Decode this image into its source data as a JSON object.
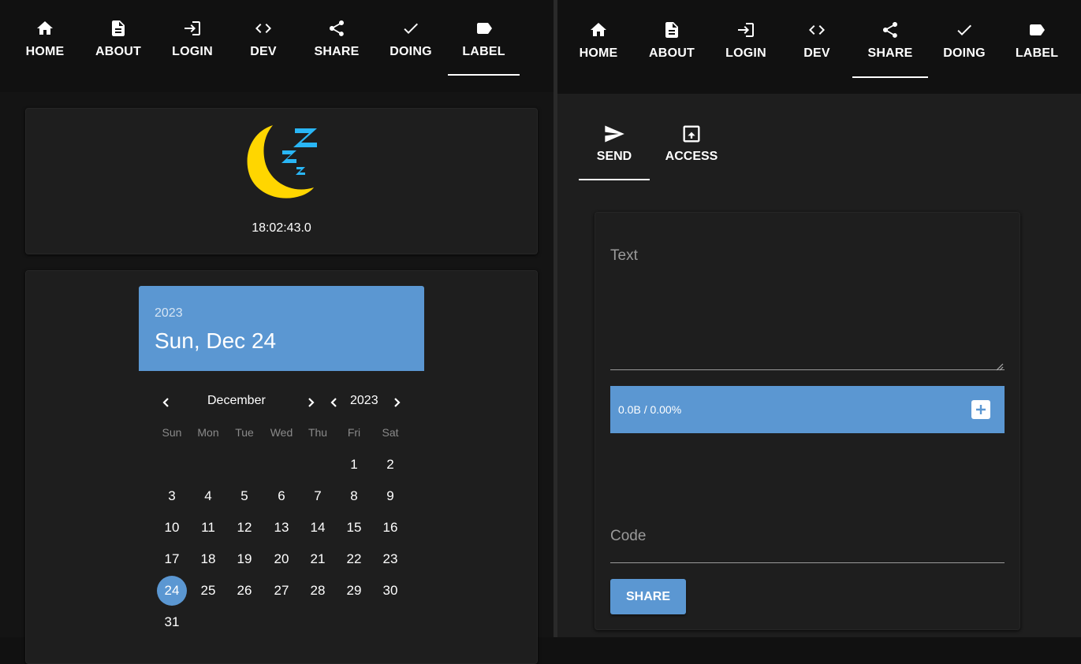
{
  "left_nav": {
    "items": [
      {
        "label": "HOME"
      },
      {
        "label": "ABOUT"
      },
      {
        "label": "LOGIN"
      },
      {
        "label": "DEV"
      },
      {
        "label": "SHARE"
      },
      {
        "label": "DOING"
      },
      {
        "label": "LABEL"
      }
    ],
    "active": "LABEL"
  },
  "right_nav": {
    "items": [
      {
        "label": "HOME"
      },
      {
        "label": "ABOUT"
      },
      {
        "label": "LOGIN"
      },
      {
        "label": "DEV"
      },
      {
        "label": "SHARE"
      },
      {
        "label": "DOING"
      },
      {
        "label": "LABEL"
      }
    ],
    "active": "SHARE"
  },
  "clock": {
    "icon": "sleeping-moon-icon",
    "time": "18:02:43.0",
    "colors": {
      "moon": "#ffd600",
      "z": "#29b6f6"
    }
  },
  "calendar": {
    "header_year": "2023",
    "header_date": "Sun, Dec 24",
    "month": "December",
    "year": "2023",
    "weekdays": [
      "Sun",
      "Mon",
      "Tue",
      "Wed",
      "Thu",
      "Fri",
      "Sat"
    ],
    "days": [
      "1",
      "2",
      "3",
      "4",
      "5",
      "6",
      "7",
      "8",
      "9",
      "10",
      "11",
      "12",
      "13",
      "14",
      "15",
      "16",
      "17",
      "18",
      "19",
      "20",
      "21",
      "22",
      "23",
      "24",
      "25",
      "26",
      "27",
      "28",
      "29",
      "30",
      "31"
    ],
    "selected": "24"
  },
  "share": {
    "tabs": [
      {
        "label": "SEND",
        "icon": "send-icon"
      },
      {
        "label": "ACCESS",
        "icon": "upload-box-icon"
      }
    ],
    "active_tab": "SEND",
    "text_label": "Text",
    "upload_status": "0.0B / 0.00%",
    "code_label": "Code",
    "share_button": "SHARE"
  },
  "colors": {
    "accent": "#5b97d2",
    "background": "#1e1e1e"
  }
}
